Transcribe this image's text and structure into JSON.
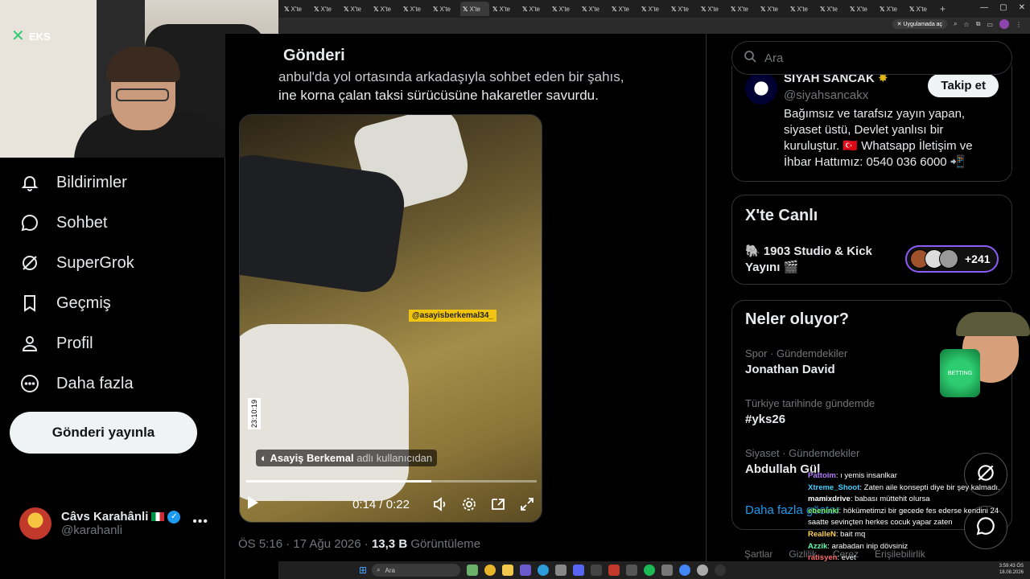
{
  "browser": {
    "tab_label": "X'te",
    "tab_count": 22,
    "app_banner": "Uygulamada aç"
  },
  "webcam": {
    "logo_text": "EKS"
  },
  "nav": {
    "items": [
      {
        "label": "Bildirimler",
        "icon": "bell-icon"
      },
      {
        "label": "Sohbet",
        "icon": "chat-bubble-icon"
      },
      {
        "label": "SuperGrok",
        "icon": "grok-icon"
      },
      {
        "label": "Geçmiş",
        "icon": "bookmark-icon"
      },
      {
        "label": "Profil",
        "icon": "person-icon"
      },
      {
        "label": "Daha fazla",
        "icon": "more-circle-icon"
      }
    ],
    "post_button": "Gönderi yayınla",
    "account": {
      "name": "Câvs Karahânli",
      "handle": "@karahanli"
    }
  },
  "post": {
    "header": "Gönderi",
    "text_line1": "anbul'da yol ortasında arkadaşıyla sohbet eden bir şahıs,",
    "text_line2": "ine korna çalan taksi sürücüsüne hakaretler savurdu.",
    "video": {
      "watermark": "@asayisberkemal34_",
      "timestamp": "23:10:19",
      "credit_name": "Asayiş Berkemal",
      "credit_suffix": "adlı kullanıcıdan",
      "current_time": "0:14",
      "separator": "/",
      "duration": "0:22",
      "progress": 0.636
    },
    "time": "ÖS 5:16 · 17 Ağu 2026 ·",
    "views": "13,3 B",
    "views_label": "Görüntüleme"
  },
  "sidebar": {
    "search_placeholder": "Ara",
    "who_to_follow": {
      "name": "SİYAH SANCAK",
      "handle": "@siyahsancakx",
      "follow_label": "Takip et",
      "bio": "Bağımsız ve tarafsız yayın yapan, siyaset üstü, Devlet yanlısı bir kuruluştur. 🇹🇷 Whatsapp İletişim ve İhbar Hattımız: 0540 036 6000 📲"
    },
    "live": {
      "title": "X'te Canlı",
      "stream_title": "🐘 1903 Studio & Kick Yayını 🎬",
      "listener_count": "+241"
    },
    "trends": {
      "title": "Neler oluyor?",
      "items": [
        {
          "context": "Spor · Gündemdekiler",
          "topic": "Jonathan David"
        },
        {
          "context": "Türkiye tarihinde gündemde",
          "topic": "#yks26"
        },
        {
          "context": "Siyaset · Gündemdekiler",
          "topic": "Abdullah Gül"
        }
      ],
      "show_more": "Daha fazla göster"
    },
    "footer": [
      "Şartlar",
      "Gizlilik",
      "Çerez",
      "Erişilebilirlik"
    ]
  },
  "chat": [
    {
      "user": "Pattoim",
      "color": "#b57cff",
      "msg": ": ı yemis insanlkar"
    },
    {
      "user": "Xtreme_Shoot",
      "color": "#3fd1ff",
      "msg": ": Zaten aile konsepti diye bir şey kalmadı."
    },
    {
      "user": "mamixdrive",
      "color": "#ffffff",
      "msg": ": babası müttehit olursa"
    },
    {
      "user": "ebeninki",
      "color": "#7cff7c",
      "msg": ": hökümetimzi bir gecede fes ederse kendini 24"
    },
    {
      "user": "",
      "color": "#ffffff",
      "msg": "saatte sevinçten herkes cocuk yapar zaten"
    },
    {
      "user": "RealleN",
      "color": "#ffd24d",
      "msg": ": bait mq"
    },
    {
      "user": "Azzik",
      "color": "#5cffb0",
      "msg": ": arabadan inip dövsiniz"
    },
    {
      "user": "ratisyen",
      "color": "#ff6b6b",
      "msg": ": evet"
    }
  ],
  "taskbar": {
    "search": "Ara",
    "clock_time": "3:59:43 ÖS",
    "clock_date": "18.08.2026"
  },
  "mascot": {
    "badge_text": "BETTING"
  }
}
